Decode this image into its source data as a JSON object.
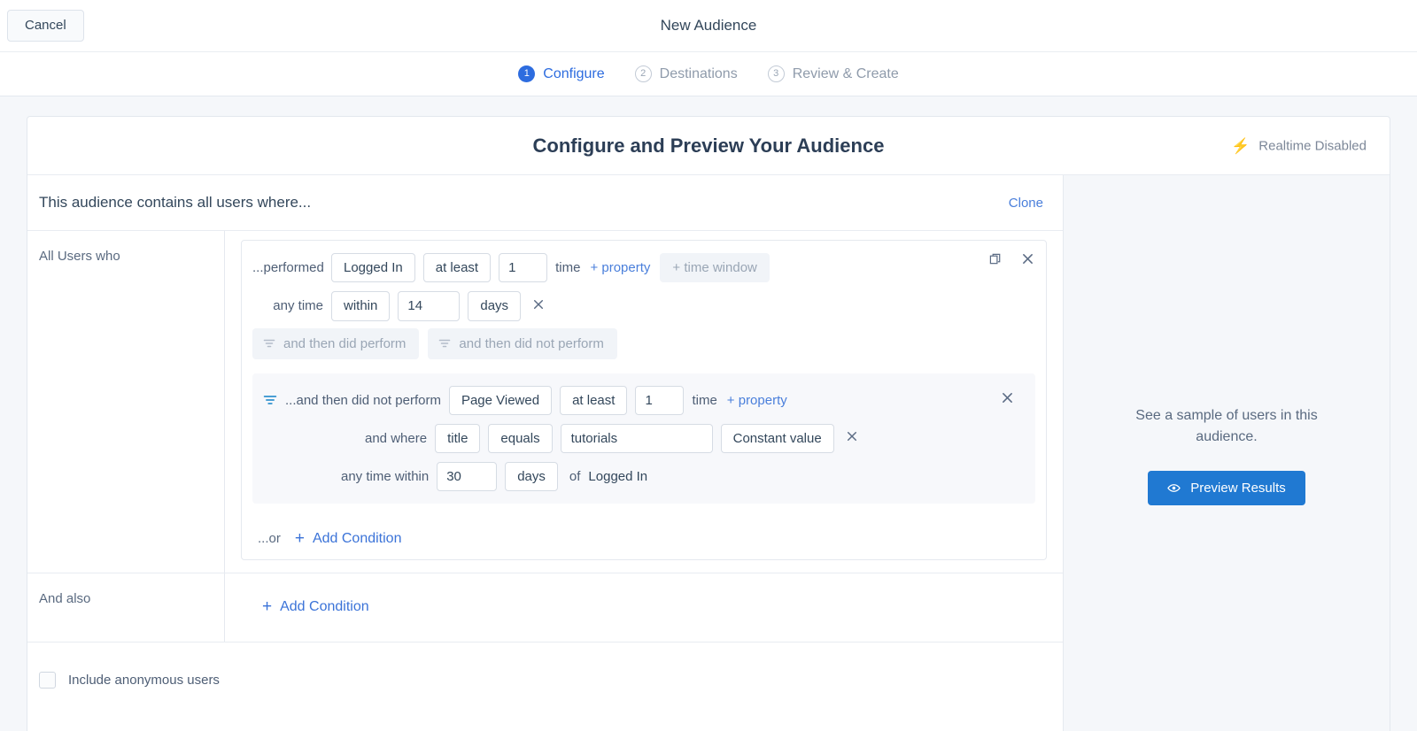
{
  "topbar": {
    "cancel_label": "Cancel",
    "title": "New Audience"
  },
  "steps": [
    {
      "num": "1",
      "label": "Configure",
      "state": "active"
    },
    {
      "num": "2",
      "label": "Destinations",
      "state": "idle"
    },
    {
      "num": "3",
      "label": "Review & Create",
      "state": "idle"
    }
  ],
  "card": {
    "title": "Configure and Preview Your Audience",
    "realtime_status": "Realtime Disabled",
    "contains_text": "This audience contains all users where...",
    "clone_label": "Clone"
  },
  "groups": [
    {
      "label": "All Users who",
      "condition": {
        "line1": {
          "prefix": "...performed",
          "event": "Logged In",
          "operator": "at least",
          "count": "1",
          "unit": "time",
          "add_property": "+ property",
          "add_time_window": "+ time window"
        },
        "line2": {
          "prefix": "any time",
          "within": "within",
          "value": "14",
          "unit": "days"
        },
        "then_buttons": [
          "and then did perform",
          "and then did not perform"
        ]
      },
      "sub_condition": {
        "line1": {
          "prefix": "...and then did not perform",
          "event": "Page Viewed",
          "operator": "at least",
          "count": "1",
          "unit": "time",
          "add_property": "+ property"
        },
        "line2": {
          "prefix": "and where",
          "property": "title",
          "comparator": "equals",
          "value": "tutorials",
          "value_type": "Constant value"
        },
        "line3": {
          "prefix": "any time within",
          "value": "30",
          "unit": "days",
          "of_label": "of",
          "of_event": "Logged In"
        }
      },
      "or_label": "...or",
      "add_condition_label": "Add Condition"
    },
    {
      "label": "And also",
      "add_condition_label": "Add Condition"
    }
  ],
  "anonymous": {
    "label": "Include anonymous users",
    "checked": false
  },
  "preview": {
    "text": "See a sample of users in this audience.",
    "button_label": "Preview Results"
  },
  "colors": {
    "accent_blue": "#2d6cdf",
    "link_blue": "#4a7fdb",
    "button_blue": "#2079d2",
    "text_dark": "#33475b",
    "text_muted": "#8f9bab",
    "filter_teal": "#4a9fd4",
    "page_bg": "#f5f7fa"
  }
}
